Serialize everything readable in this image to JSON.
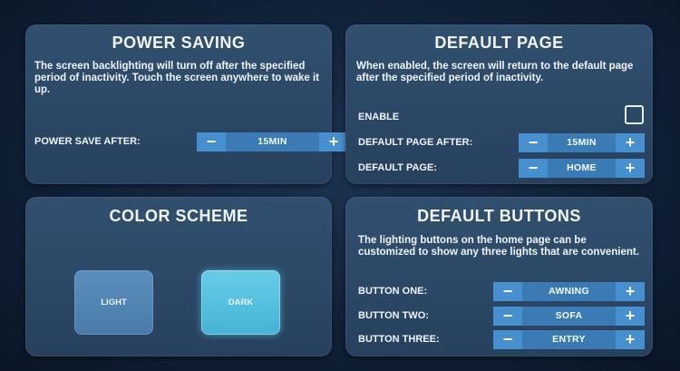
{
  "power_saving": {
    "title": "POWER SAVING",
    "description": "The screen backlighting will turn off after the specified period of inactivity. Touch the screen anywhere to wake it up.",
    "power_save_after_label": "POWER SAVE AFTER:",
    "power_save_after_value": "15MIN",
    "minus": "−",
    "plus": "+"
  },
  "default_page": {
    "title": "DEFAULT PAGE",
    "description": "When enabled, the screen will return to the default page after the specified period of inactivity.",
    "enable_label": "ENABLE",
    "enable_checked": false,
    "after_label": "DEFAULT PAGE AFTER:",
    "after_value": "15MIN",
    "page_label": "DEFAULT PAGE:",
    "page_value": "HOME",
    "minus": "−",
    "plus": "+"
  },
  "color_scheme": {
    "title": "COLOR SCHEME",
    "light_label": "LIGHT",
    "dark_label": "DARK",
    "selected": "DARK"
  },
  "default_buttons": {
    "title": "DEFAULT BUTTONS",
    "description": "The lighting buttons on the home page can be customized to show any three lights that are convenient.",
    "button_one_label": "BUTTON ONE:",
    "button_one_value": "AWNING",
    "button_two_label": "BUTTON TWO:",
    "button_two_value": "SOFA",
    "button_three_label": "BUTTON THREE:",
    "button_three_value": "ENTRY",
    "minus": "−",
    "plus": "+"
  },
  "colors": {
    "background": "#0f2036",
    "panel": "#2b4866",
    "stepper": "#3e82bf",
    "dark_selected": "#45b3d6"
  }
}
